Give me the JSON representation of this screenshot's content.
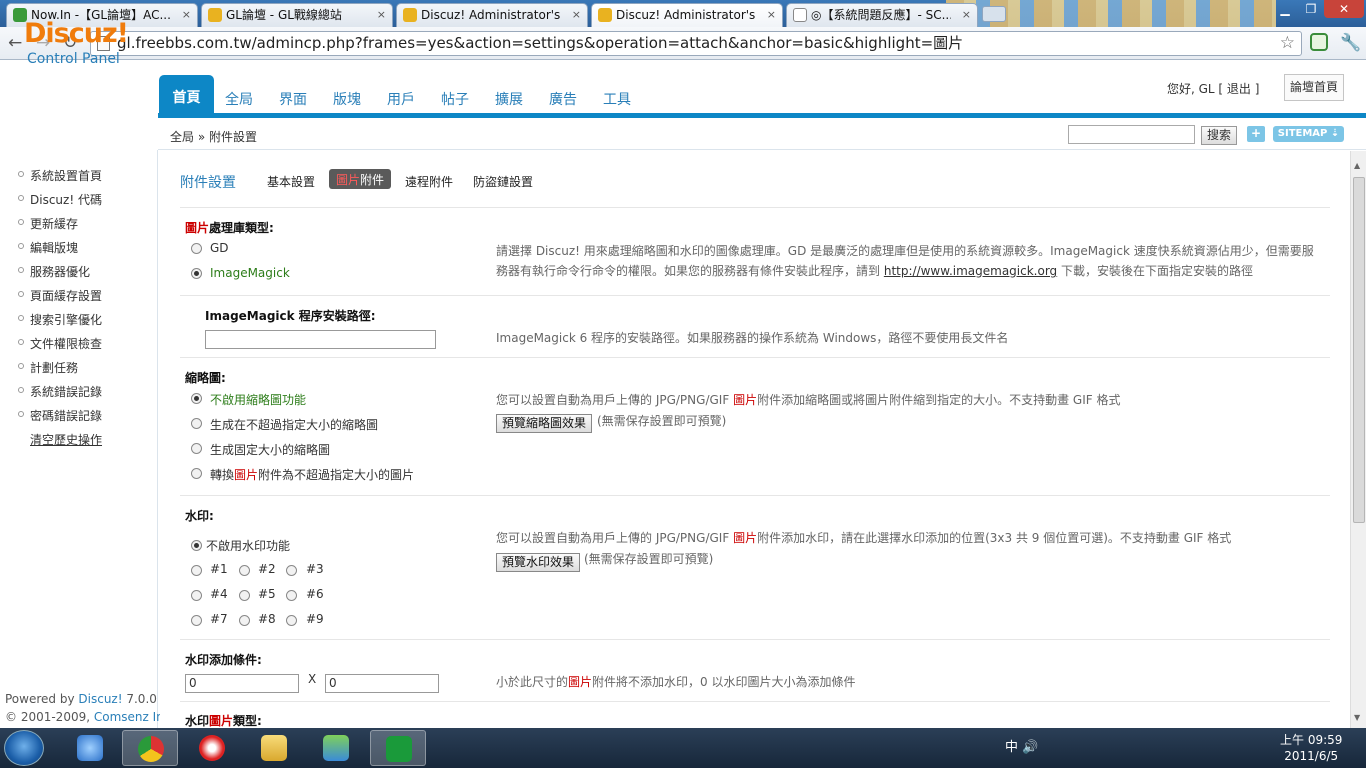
{
  "browser": {
    "tabs": [
      {
        "title": "Now.In -【GL論壇】AC..."
      },
      {
        "title": "GL論壇 - GL戰線總站"
      },
      {
        "title": "Discuz! Administrator's ..."
      },
      {
        "title": "Discuz! Administrator's ..."
      },
      {
        "title": "◎【系統問題反應】- SC..."
      }
    ],
    "url": "gl.freebbs.com.tw/admincp.php?frames=yes&action=settings&operation=attach&anchor=basic&highlight=圖片",
    "close_glyph": "×"
  },
  "header": {
    "logo": "Discuz!",
    "logo_sub": "Control Panel",
    "nav": [
      "首頁",
      "全局",
      "界面",
      "版塊",
      "用戶",
      "帖子",
      "擴展",
      "廣告",
      "工具"
    ],
    "greeting": "您好, GL [ 退出 ]",
    "home_button": "論壇首頁"
  },
  "breadcrumb": "全局 » 附件設置",
  "search": {
    "button": "搜索",
    "plus": "+",
    "sitemap": "SITEMAP ⇣"
  },
  "sidebar": {
    "items": [
      "系統設置首頁",
      "Discuz! 代碼",
      "更新緩存",
      "編輯版塊",
      "服務器優化",
      "頁面緩存設置",
      "搜索引擎優化",
      "文件權限檢查",
      "計劃任務",
      "系統錯誤記錄",
      "密碼錯誤記錄"
    ],
    "link": "清空歷史操作",
    "footer_powered": "Powered by",
    "footer_brand": "Discuz!",
    "footer_version": "7.0.0",
    "footer_copyright": "© 2001-2009,",
    "footer_company": "Comsenz Inc."
  },
  "subnav": {
    "title": "附件設置",
    "tabs": [
      "基本設置",
      "圖片附件",
      "遠程附件",
      "防盜鏈設置"
    ],
    "active_red": "圖片",
    "active_rest": "附件"
  },
  "settings": {
    "lib": {
      "label_red": "圖片",
      "label_rest": "處理庫類型:",
      "options": [
        "GD",
        "ImageMagick"
      ],
      "tip_line1": "請選擇 Discuz! 用來處理縮略圖和水印的圖像處理庫。GD 是最廣泛的處理庫但是使用的系統資源較多。ImageMagick 速度快系統資源佔用少，但需要服",
      "tip_line2": "務器有執行命令行命令的權限。如果您的服務器有條件安裝此程序，請到",
      "tip_link": "http://www.imagemagick.org",
      "tip_line3": "下載，安裝後在下面指定安裝的路徑"
    },
    "impath": {
      "label": "ImageMagick 程序安裝路徑:",
      "value": "",
      "tip": "ImageMagick 6 程序的安裝路徑。如果服務器的操作系統為 Windows，路徑不要使用長文件名"
    },
    "thumb": {
      "label": "縮略圖:",
      "options": [
        "不啟用縮略圖功能",
        "生成在不超過指定大小的縮略圖",
        "生成固定大小的縮略圖"
      ],
      "option4_pre": "轉換",
      "option4_red": "圖片",
      "option4_post": "附件為不超過指定大小的圖片",
      "tip_pre": "您可以設置自動為用戶上傳的 JPG/PNG/GIF",
      "tip_red": "圖片",
      "tip_post": "附件添加縮略圖或將圖片附件縮到指定的大小。不支持動畫 GIF 格式",
      "preview_button": "預覽縮略圖效果",
      "preview_note": "(無需保存設置即可預覽)"
    },
    "watermark": {
      "label": "水印:",
      "disable": "不啟用水印功能",
      "positions": [
        "#1",
        "#2",
        "#3",
        "#4",
        "#5",
        "#6",
        "#7",
        "#8",
        "#9"
      ],
      "tip_pre": "您可以設置自動為用戶上傳的 JPG/PNG/GIF",
      "tip_red": "圖片",
      "tip_post": "附件添加水印，請在此選擇水印添加的位置(3x3 共 9 個位置可選)。不支持動畫 GIF 格式",
      "preview_button": "預覽水印效果",
      "preview_note": "(無需保存設置即可預覽)"
    },
    "condition": {
      "label": "水印添加條件:",
      "width": "0",
      "x": "X",
      "height": "0",
      "tip_pre": "小於此尺寸的",
      "tip_red": "圖片",
      "tip_post": "附件將不添加水印，0 以水印圖片大小為添加條件"
    },
    "wmtype": {
      "label_pre": "水印",
      "label_red": "圖片",
      "label_post": "類型:"
    }
  },
  "taskbar": {
    "tray": "中",
    "time": "上午 09:59",
    "date": "2011/6/5"
  }
}
